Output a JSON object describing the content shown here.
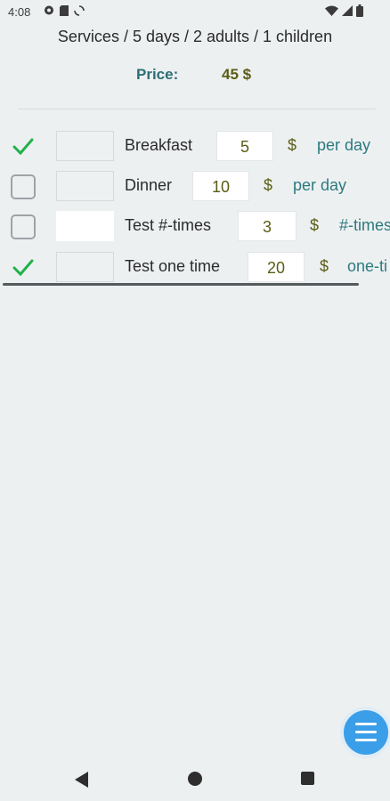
{
  "status": {
    "time": "4:08",
    "left_icons": [
      "notification-chat-icon",
      "sd-card-icon",
      "sync-icon"
    ],
    "right_icons": [
      "wifi-icon",
      "cell-signal-icon",
      "battery-icon"
    ]
  },
  "header": {
    "title": "Services / 5 days / 2 adults / 1 children",
    "price_label": "Price:",
    "price_value": "45 $"
  },
  "services": [
    {
      "name": "Breakfast",
      "checked": true,
      "amount": "5",
      "currency": "$",
      "unit": "per day"
    },
    {
      "name": "Dinner",
      "checked": false,
      "amount": "10",
      "currency": "$",
      "unit": "per day"
    },
    {
      "name": "Test #-times",
      "checked": false,
      "amount": "3",
      "currency": "$",
      "unit": "#-times"
    },
    {
      "name": "Test one time",
      "checked": true,
      "amount": "20",
      "currency": "$",
      "unit": "one-ti"
    }
  ],
  "colors": {
    "accent_teal": "#2c6f73",
    "amount_olive": "#5b5d14",
    "check_green": "#22b14c",
    "fab_blue": "#3a9ee8"
  },
  "fab": {
    "icon": "menu-icon"
  },
  "nav": {
    "icons": [
      "back-icon",
      "home-icon",
      "recents-icon"
    ]
  }
}
